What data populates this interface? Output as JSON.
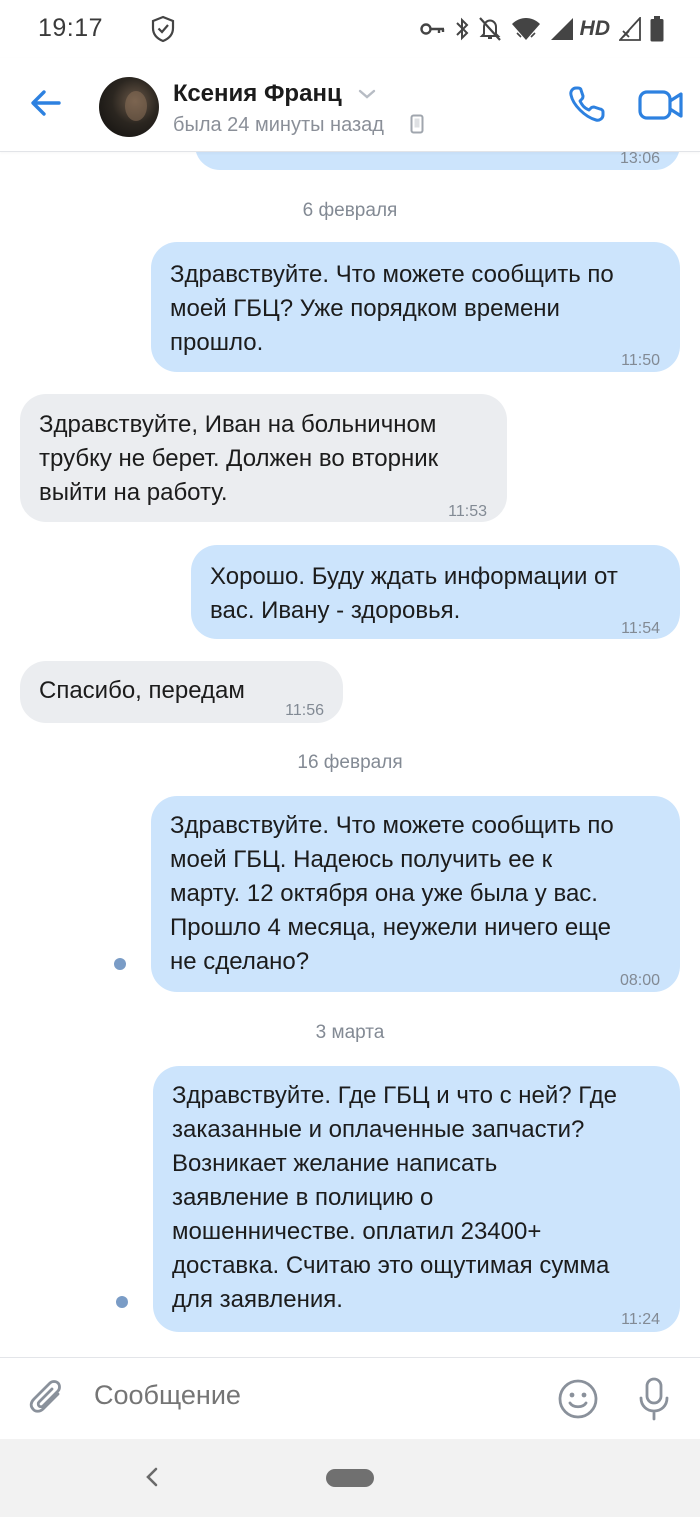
{
  "status_bar": {
    "time": "19:17",
    "hd": "HD"
  },
  "header": {
    "contact_name": "Ксения Франц",
    "last_seen": "была 24 минуты назад",
    "accent_color": "#2d81e0"
  },
  "messages": [
    {
      "type": "date",
      "text": "6 февраля"
    },
    {
      "type": "outgoing",
      "text": "Здравствуйте. Что можете сообщить по\nмоей ГБЦ? Уже порядком времени\nпрошло.",
      "time": "11:50"
    },
    {
      "type": "incoming",
      "text": "Здравствуйте, Иван на больничном\nтрубку не берет. Должен во вторник\nвыйти на работу.",
      "time": "11:53"
    },
    {
      "type": "outgoing",
      "text": "Хорошо. Буду ждать информации от\nвас. Ивану -  здоровья.",
      "time": "11:54"
    },
    {
      "type": "incoming",
      "text": "Спасибо, передам",
      "time": "11:56"
    },
    {
      "type": "date",
      "text": "16 февраля"
    },
    {
      "type": "outgoing",
      "text": "Здравствуйте. Что можете сообщить по\nмоей ГБЦ. Надеюсь получить ее к\nмарту. 12 октября она уже была у вас.\nПрошло 4 месяца, неужели ничего еще\nне сделано?",
      "time": "08:00",
      "unread": true
    },
    {
      "type": "date",
      "text": "3 марта"
    },
    {
      "type": "outgoing",
      "text": "Здравствуйте. Где ГБЦ и что с ней? Где\nзаказанные и оплаченные запчасти?\nВозникает желание написать\nзаявление в полицию о\nмошенничестве. оплатил 23400+\nдоставка. Считаю это ощутимая сумма\nдля заявления.",
      "time": "11:24",
      "unread": true
    }
  ],
  "composer": {
    "placeholder": "Сообщение"
  },
  "colors": {
    "outgoing_bubble": "#cce4fc",
    "incoming_bubble": "#ebedf0",
    "unread_dot": "#7a9cc6"
  },
  "icons": [
    "shield-icon",
    "key-icon",
    "bluetooth-icon",
    "mute-icon",
    "wifi-icon",
    "signal-icon",
    "battery-icon",
    "back-arrow-icon",
    "call-icon",
    "video-icon",
    "attach-icon",
    "emoji-icon",
    "mic-icon"
  ]
}
